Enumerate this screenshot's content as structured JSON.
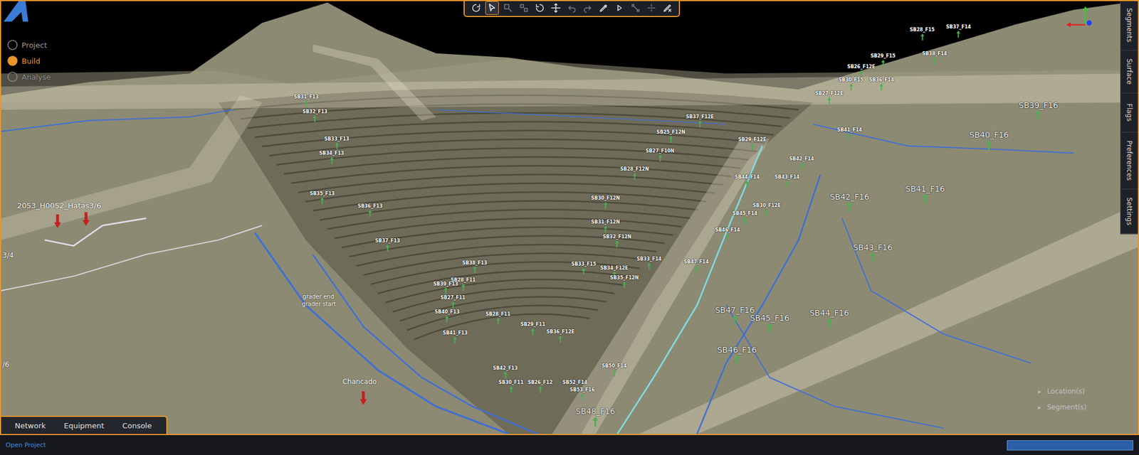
{
  "toolbar": {
    "tools": [
      {
        "selected": false,
        "disabled": false
      },
      {
        "selected": true,
        "disabled": false
      },
      {
        "selected": false,
        "disabled": true
      },
      {
        "selected": false,
        "disabled": true
      },
      {
        "selected": false,
        "disabled": false
      },
      {
        "selected": false,
        "disabled": false
      },
      {
        "selected": false,
        "disabled": true
      },
      {
        "selected": false,
        "disabled": true
      },
      {
        "selected": false,
        "disabled": false
      },
      {
        "selected": false,
        "disabled": false
      },
      {
        "selected": false,
        "disabled": true
      },
      {
        "selected": false,
        "disabled": true
      },
      {
        "selected": false,
        "disabled": false
      }
    ]
  },
  "nav": [
    {
      "label": "Project",
      "selected": false
    },
    {
      "label": "Build",
      "selected": true
    },
    {
      "label": "Analyse",
      "selected": false
    }
  ],
  "side_tabs": [
    {
      "label": "Segments",
      "selected": false
    },
    {
      "label": "Surface",
      "selected": false
    },
    {
      "label": "Flags",
      "selected": false
    },
    {
      "label": "Preferences",
      "selected": false
    },
    {
      "label": "Settings",
      "selected": false
    }
  ],
  "bottom_tabs": [
    {
      "label": "Network",
      "selected": false
    },
    {
      "label": "Equipment",
      "selected": false
    },
    {
      "label": "Console",
      "selected": false
    }
  ],
  "expanders": [
    {
      "arrow": "▸",
      "label": "Location(s)",
      "expanded": false
    },
    {
      "arrow": "▸",
      "label": "Segment(s)",
      "expanded": false
    }
  ],
  "status_bar": {
    "link": "Open Project",
    "progress": {
      "level": 1
    }
  },
  "flags": [
    {
      "text": "SB28_F15",
      "kind": "small",
      "color": "#4caf50"
    },
    {
      "text": "SB37_F14",
      "kind": "small",
      "color": "#4caf50"
    },
    {
      "text": "SB29_F15",
      "kind": "small",
      "color": "#4caf50"
    },
    {
      "text": "SB38_F14",
      "kind": "small",
      "color": "#4caf50"
    },
    {
      "text": "SB26_F12E",
      "kind": "small",
      "color": "#4caf50"
    },
    {
      "text": "SB30_F15",
      "kind": "small",
      "color": "#4caf50"
    },
    {
      "text": "SB36_F14",
      "kind": "small",
      "color": "#4caf50"
    },
    {
      "text": "SB27_F12E",
      "kind": "small",
      "color": "#4caf50"
    },
    {
      "text": "SB39_F16",
      "kind": "large",
      "color": "#4caf50"
    },
    {
      "text": "SB37_F12E",
      "kind": "small",
      "color": "#4caf50"
    },
    {
      "text": "SB41_F14",
      "kind": "small",
      "color": "#4caf50"
    },
    {
      "text": "SB29_F12E",
      "kind": "small",
      "color": "#4caf50"
    },
    {
      "text": "SB40_F16",
      "kind": "large",
      "color": "#4caf50"
    },
    {
      "text": "SB25_F12N",
      "kind": "small",
      "color": "#4caf50"
    },
    {
      "text": "SB27_F10N",
      "kind": "small",
      "color": "#4caf50"
    },
    {
      "text": "SB42_F14",
      "kind": "small",
      "color": "#4caf50"
    },
    {
      "text": "SB28_F12N",
      "kind": "small",
      "color": "#4caf50"
    },
    {
      "text": "SB44_F14",
      "kind": "small",
      "color": "#4caf50"
    },
    {
      "text": "SB43_F14",
      "kind": "small",
      "color": "#4caf50"
    },
    {
      "text": "SB41_F16",
      "kind": "large",
      "color": "#4caf50"
    },
    {
      "text": "SB42_F16",
      "kind": "large",
      "color": "#4caf50"
    },
    {
      "text": "SB30_F12N",
      "kind": "small",
      "color": "#4caf50"
    },
    {
      "text": "SB30_F12E",
      "kind": "small",
      "color": "#4caf50"
    },
    {
      "text": "SB45_F14",
      "kind": "small",
      "color": "#4caf50"
    },
    {
      "text": "SB31_F12N",
      "kind": "small",
      "color": "#4caf50"
    },
    {
      "text": "SB46_F14",
      "kind": "small",
      "color": "#4caf50"
    },
    {
      "text": "SB32_F12N",
      "kind": "small",
      "color": "#4caf50"
    },
    {
      "text": "SB43_F16",
      "kind": "large",
      "color": "#4caf50"
    },
    {
      "text": "SB33_F14",
      "kind": "small",
      "color": "#4caf50"
    },
    {
      "text": "SB47_F14",
      "kind": "small",
      "color": "#4caf50"
    },
    {
      "text": "SB33_F15",
      "kind": "small",
      "color": "#4caf50"
    },
    {
      "text": "SB34_F12E",
      "kind": "small",
      "color": "#4caf50"
    },
    {
      "text": "SB35_F12N",
      "kind": "small",
      "color": "#4caf50"
    },
    {
      "text": "SB31_F13",
      "kind": "small",
      "color": "#4caf50"
    },
    {
      "text": "SB32_F13",
      "kind": "small",
      "color": "#4caf50"
    },
    {
      "text": "SB33_F13",
      "kind": "small",
      "color": "#4caf50"
    },
    {
      "text": "SB34_F13",
      "kind": "small",
      "color": "#4caf50"
    },
    {
      "text": "SB35_F13",
      "kind": "small",
      "color": "#4caf50"
    },
    {
      "text": "SB36_F13",
      "kind": "small",
      "color": "#4caf50"
    },
    {
      "text": "SB37_F13",
      "kind": "small",
      "color": "#4caf50"
    },
    {
      "text": "SB38_F13",
      "kind": "small",
      "color": "#4caf50"
    },
    {
      "text": "SB28_F11",
      "kind": "small",
      "color": "#4caf50"
    },
    {
      "text": "SB39_F13",
      "kind": "small",
      "color": "#4caf50"
    },
    {
      "text": "SB27_F11",
      "kind": "small",
      "color": "#4caf50"
    },
    {
      "text": "SB40_F13",
      "kind": "small",
      "color": "#4caf50"
    },
    {
      "text": "SB28_F11",
      "kind": "small",
      "color": "#4caf50"
    },
    {
      "text": "SB41_F13",
      "kind": "small",
      "color": "#4caf50"
    },
    {
      "text": "SB29_F11",
      "kind": "small",
      "color": "#4caf50"
    },
    {
      "text": "SB36_F12E",
      "kind": "small",
      "color": "#4caf50"
    },
    {
      "text": "SB44_F16",
      "kind": "large",
      "color": "#4caf50"
    },
    {
      "text": "SB45_F16",
      "kind": "large",
      "color": "#4caf50"
    },
    {
      "text": "SB47_F16",
      "kind": "large",
      "color": "#4caf50"
    },
    {
      "text": "SB46_F16",
      "kind": "large",
      "color": "#4caf50"
    },
    {
      "text": "SB50_F14",
      "kind": "small",
      "color": "#4caf50"
    },
    {
      "text": "SB42_F13",
      "kind": "small",
      "color": "#4caf50"
    },
    {
      "text": "SB30_F11",
      "kind": "small",
      "color": "#4caf50"
    },
    {
      "text": "SB26_F12",
      "kind": "small",
      "color": "#4caf50"
    },
    {
      "text": "SB52_F14",
      "kind": "small",
      "color": "#4caf50"
    },
    {
      "text": "SB53_F16",
      "kind": "small",
      "color": "#4caf50"
    },
    {
      "text": "SB48_F16",
      "kind": "large",
      "color": "#4caf50"
    }
  ],
  "notes": [
    {
      "text": "2053_H0052_Hatas3/6"
    },
    {
      "text": "3/4"
    },
    {
      "text": "/6"
    },
    {
      "text": "Chancado"
    },
    {
      "text": "grader end"
    },
    {
      "text": "grader start"
    }
  ],
  "markers": [
    {
      "color": "#c81e1e"
    },
    {
      "color": "#c81e1e"
    },
    {
      "color": "#c81e1e"
    }
  ]
}
